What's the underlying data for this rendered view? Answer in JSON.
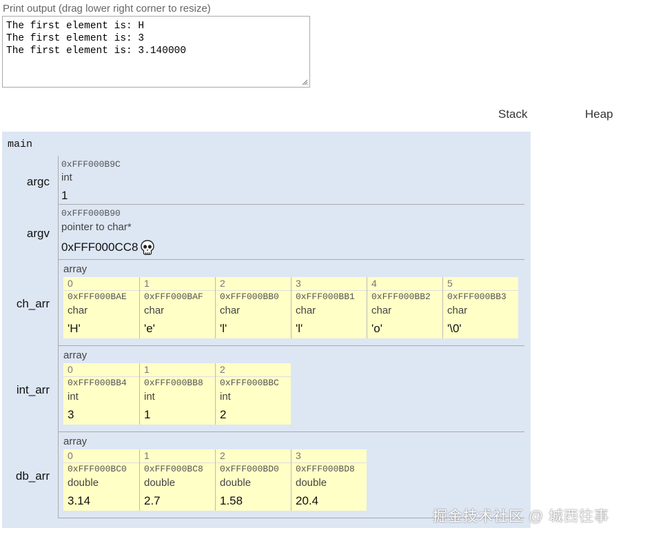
{
  "print_output": {
    "label": "Print output (drag lower right corner to resize)",
    "lines": "The first element is: H\nThe first element is: 3\nThe first element is: 3.140000"
  },
  "headers": {
    "stack": "Stack",
    "heap": "Heap"
  },
  "frame": {
    "name": "main",
    "argc": {
      "name": "argc",
      "addr": "0xFFF000B9C",
      "type": "int",
      "value": "1"
    },
    "argv": {
      "name": "argv",
      "addr": "0xFFF000B90",
      "type": "pointer to char*",
      "value": "0xFFF000CC8",
      "icon": "skull-icon"
    },
    "ch_arr": {
      "name": "ch_arr",
      "label": "array",
      "cells": [
        {
          "idx": "0",
          "addr": "0xFFF000BAE",
          "type": "char",
          "value": "'H'"
        },
        {
          "idx": "1",
          "addr": "0xFFF000BAF",
          "type": "char",
          "value": "'e'"
        },
        {
          "idx": "2",
          "addr": "0xFFF000BB0",
          "type": "char",
          "value": "'l'"
        },
        {
          "idx": "3",
          "addr": "0xFFF000BB1",
          "type": "char",
          "value": "'l'"
        },
        {
          "idx": "4",
          "addr": "0xFFF000BB2",
          "type": "char",
          "value": "'o'"
        },
        {
          "idx": "5",
          "addr": "0xFFF000BB3",
          "type": "char",
          "value": "'\\0'"
        }
      ]
    },
    "int_arr": {
      "name": "int_arr",
      "label": "array",
      "cells": [
        {
          "idx": "0",
          "addr": "0xFFF000BB4",
          "type": "int",
          "value": "3"
        },
        {
          "idx": "1",
          "addr": "0xFFF000BB8",
          "type": "int",
          "value": "1"
        },
        {
          "idx": "2",
          "addr": "0xFFF000BBC",
          "type": "int",
          "value": "2"
        }
      ]
    },
    "db_arr": {
      "name": "db_arr",
      "label": "array",
      "cells": [
        {
          "idx": "0",
          "addr": "0xFFF000BC0",
          "type": "double",
          "value": "3.14"
        },
        {
          "idx": "1",
          "addr": "0xFFF000BC8",
          "type": "double",
          "value": "2.7"
        },
        {
          "idx": "2",
          "addr": "0xFFF000BD0",
          "type": "double",
          "value": "1.58"
        },
        {
          "idx": "3",
          "addr": "0xFFF000BD8",
          "type": "double",
          "value": "20.4"
        }
      ]
    }
  },
  "watermark": "掘金技术社区 @ 城西往事",
  "colors": {
    "frame_bg": "#dde6f3",
    "cell_bg": "#ffffc6"
  }
}
